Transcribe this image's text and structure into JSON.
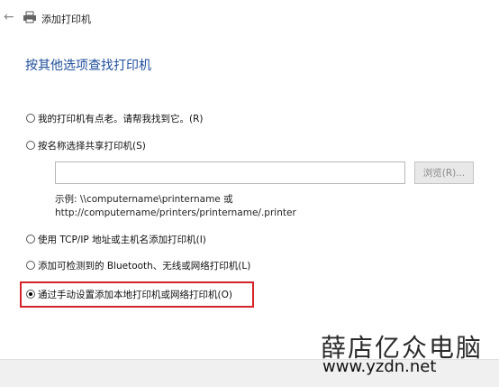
{
  "window": {
    "title": "添加打印机",
    "back_icon": "back-arrow-icon",
    "printer_icon": "printer-icon"
  },
  "heading": "按其他选项查找打印机",
  "options": [
    {
      "label": "我的打印机有点老。请帮我找到它。(R)",
      "checked": false
    },
    {
      "label": "按名称选择共享打印机(S)",
      "checked": false
    },
    {
      "label": "使用 TCP/IP 地址或主机名添加打印机(I)",
      "checked": false
    },
    {
      "label": "添加可检测到的 Bluetooth、无线或网络打印机(L)",
      "checked": false
    },
    {
      "label": "通过手动设置添加本地打印机或网络打印机(O)",
      "checked": true
    }
  ],
  "share_name": {
    "value": "",
    "browse_label": "浏览(R)..."
  },
  "example": {
    "line1": "示例: \\\\computername\\printername 或",
    "line2": "http://computername/printers/printername/.printer"
  },
  "highlight_color": "#d4232a",
  "watermark": {
    "brand": "薛店亿众电脑",
    "url": "www.yzdn.net"
  }
}
